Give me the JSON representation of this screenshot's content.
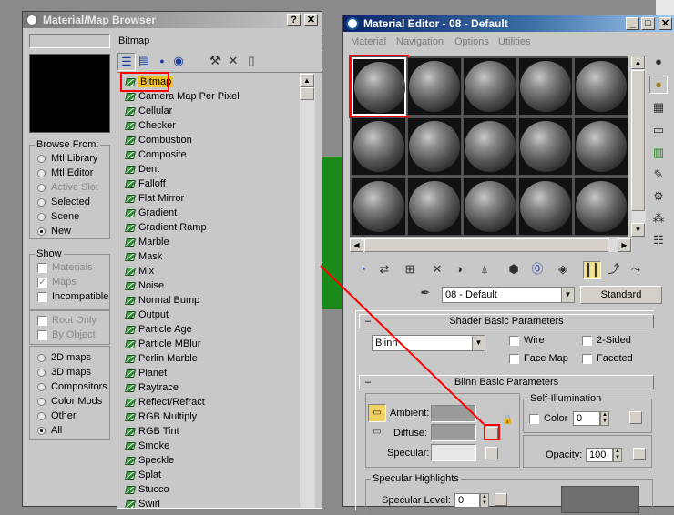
{
  "browser": {
    "title": "Material/Map Browser",
    "selected_name": "Bitmap",
    "browse_from": {
      "label": "Browse From:",
      "options": [
        "Mtl Library",
        "Mtl Editor",
        "Active Slot",
        "Selected",
        "Scene",
        "New"
      ],
      "selected": "New"
    },
    "show": {
      "label": "Show",
      "options": [
        "Materials",
        "Maps",
        "Incompatible"
      ],
      "extra": [
        "Root Only",
        "By Object"
      ]
    },
    "filters": {
      "options": [
        "2D maps",
        "3D maps",
        "Compositors",
        "Color Mods",
        "Other",
        "All"
      ],
      "selected": "All"
    },
    "maps": [
      "Bitmap",
      "Camera Map Per Pixel",
      "Cellular",
      "Checker",
      "Combustion",
      "Composite",
      "Dent",
      "Falloff",
      "Flat Mirror",
      "Gradient",
      "Gradient Ramp",
      "Marble",
      "Mask",
      "Mix",
      "Noise",
      "Normal Bump",
      "Output",
      "Particle Age",
      "Particle MBlur",
      "Perlin Marble",
      "Planet",
      "Raytrace",
      "Reflect/Refract",
      "RGB Multiply",
      "RGB Tint",
      "Smoke",
      "Speckle",
      "Splat",
      "Stucco",
      "Swirl"
    ]
  },
  "editor": {
    "title": "Material Editor - 08 - Default",
    "menu": [
      "Material",
      "Navigation",
      "Options",
      "Utilities"
    ],
    "material_name": "08 - Default",
    "type_button": "Standard",
    "shader": {
      "header": "Shader Basic Parameters",
      "shader_value": "Blinn",
      "checks": [
        "Wire",
        "2-Sided",
        "Face Map",
        "Faceted"
      ]
    },
    "blinn": {
      "header": "Blinn Basic Parameters",
      "ambient": "Ambient:",
      "diffuse": "Diffuse:",
      "specular": "Specular:",
      "self_illum": "Self-Illumination",
      "color_label": "Color",
      "color_value": "0",
      "opacity_label": "Opacity:",
      "opacity_value": "100",
      "spec_highlights": "Specular Highlights",
      "spec_level_label": "Specular Level:",
      "spec_level_value": "0"
    }
  },
  "colors": {
    "title_active": "#0a246a",
    "highlight_red": "#ff0000",
    "viewport_green": "#1a8a1a",
    "panel_gray": "#c8c8c8"
  }
}
